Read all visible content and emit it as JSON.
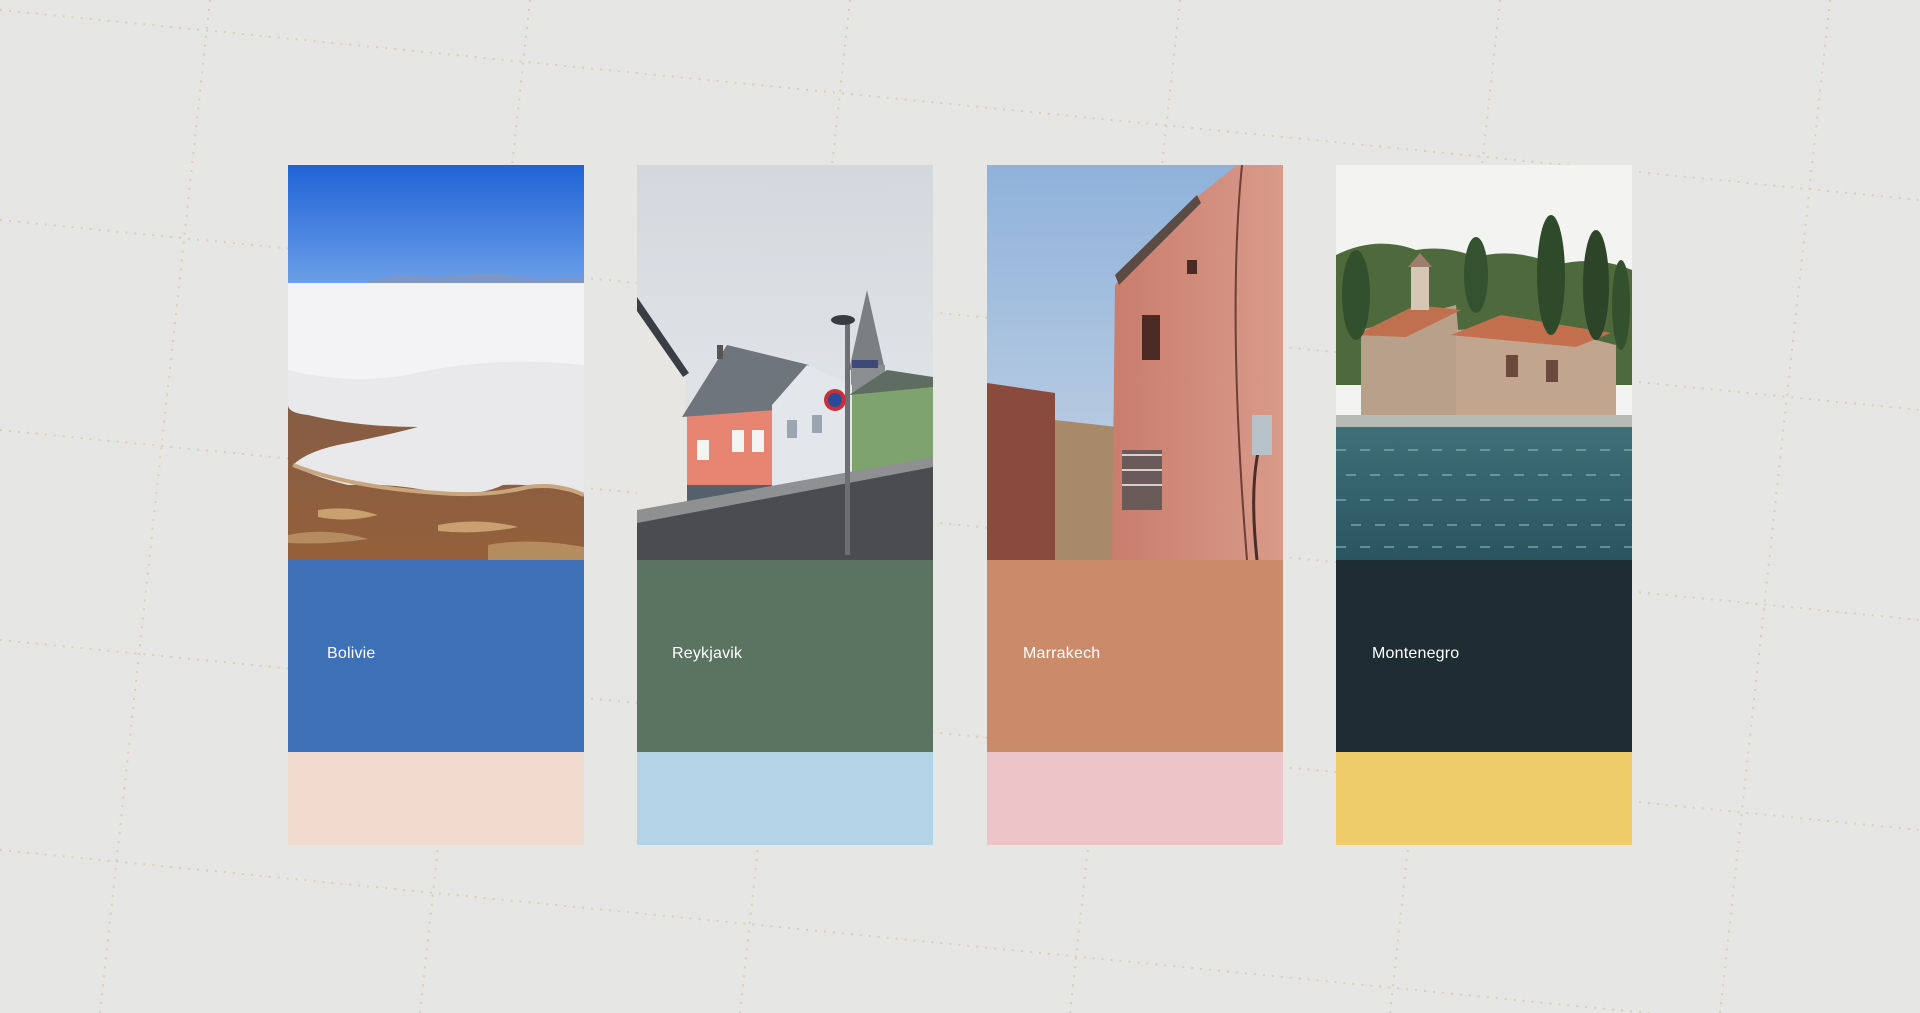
{
  "palettes": [
    {
      "name": "Bolivie",
      "main_color": "#3d70b6",
      "accent_color": "#f1dbcf",
      "photo": "salt-flat-photo"
    },
    {
      "name": "Reykjavik",
      "main_color": "#5a7461",
      "accent_color": "#b3d4e7",
      "photo": "street-houses-photo"
    },
    {
      "name": "Marrakech",
      "main_color": "#cb8a69",
      "accent_color": "#edc4c7",
      "photo": "pink-building-photo"
    },
    {
      "name": "Montenegro",
      "main_color": "#1e2d33",
      "accent_color": "#eecc6a",
      "photo": "island-church-photo"
    }
  ]
}
